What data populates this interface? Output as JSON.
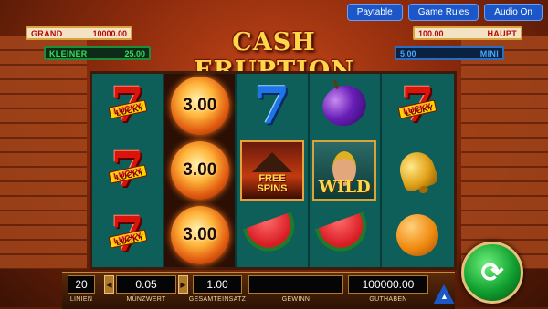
{
  "nav": {
    "paytable": "Paytable",
    "game_rules": "Game Rules",
    "audio": "Audio On"
  },
  "jackpots": {
    "grand": {
      "label": "GRAND",
      "value": "10000.00"
    },
    "kleiner": {
      "label": "KLEINER",
      "value": "25.00"
    },
    "haupt": {
      "label": "HAUPT",
      "value": "100.00"
    },
    "mini": {
      "label": "MINI",
      "value": "5.00"
    }
  },
  "logo": "CASH ERUPTION",
  "symbols": {
    "lucky": "LUCKY",
    "fireball_value": "3.00",
    "free_line1": "FREE",
    "free_line2": "SPINS",
    "wild": "WILD"
  },
  "meters": {
    "lines": {
      "value": "20",
      "label": "LINIEN"
    },
    "coin_value": {
      "value": "0.05",
      "label": "MÜNZWERT"
    },
    "total_bet": {
      "value": "1.00",
      "label": "GESAMTEINSATZ"
    },
    "win": {
      "value": "",
      "label": "GEWINN"
    },
    "credit": {
      "value": "100000.00",
      "label": "GUTHABEN"
    }
  },
  "colors": {
    "reel_bg": "#0e5e5a",
    "gold": "#ffd84a",
    "spin_green": "#10a030"
  }
}
